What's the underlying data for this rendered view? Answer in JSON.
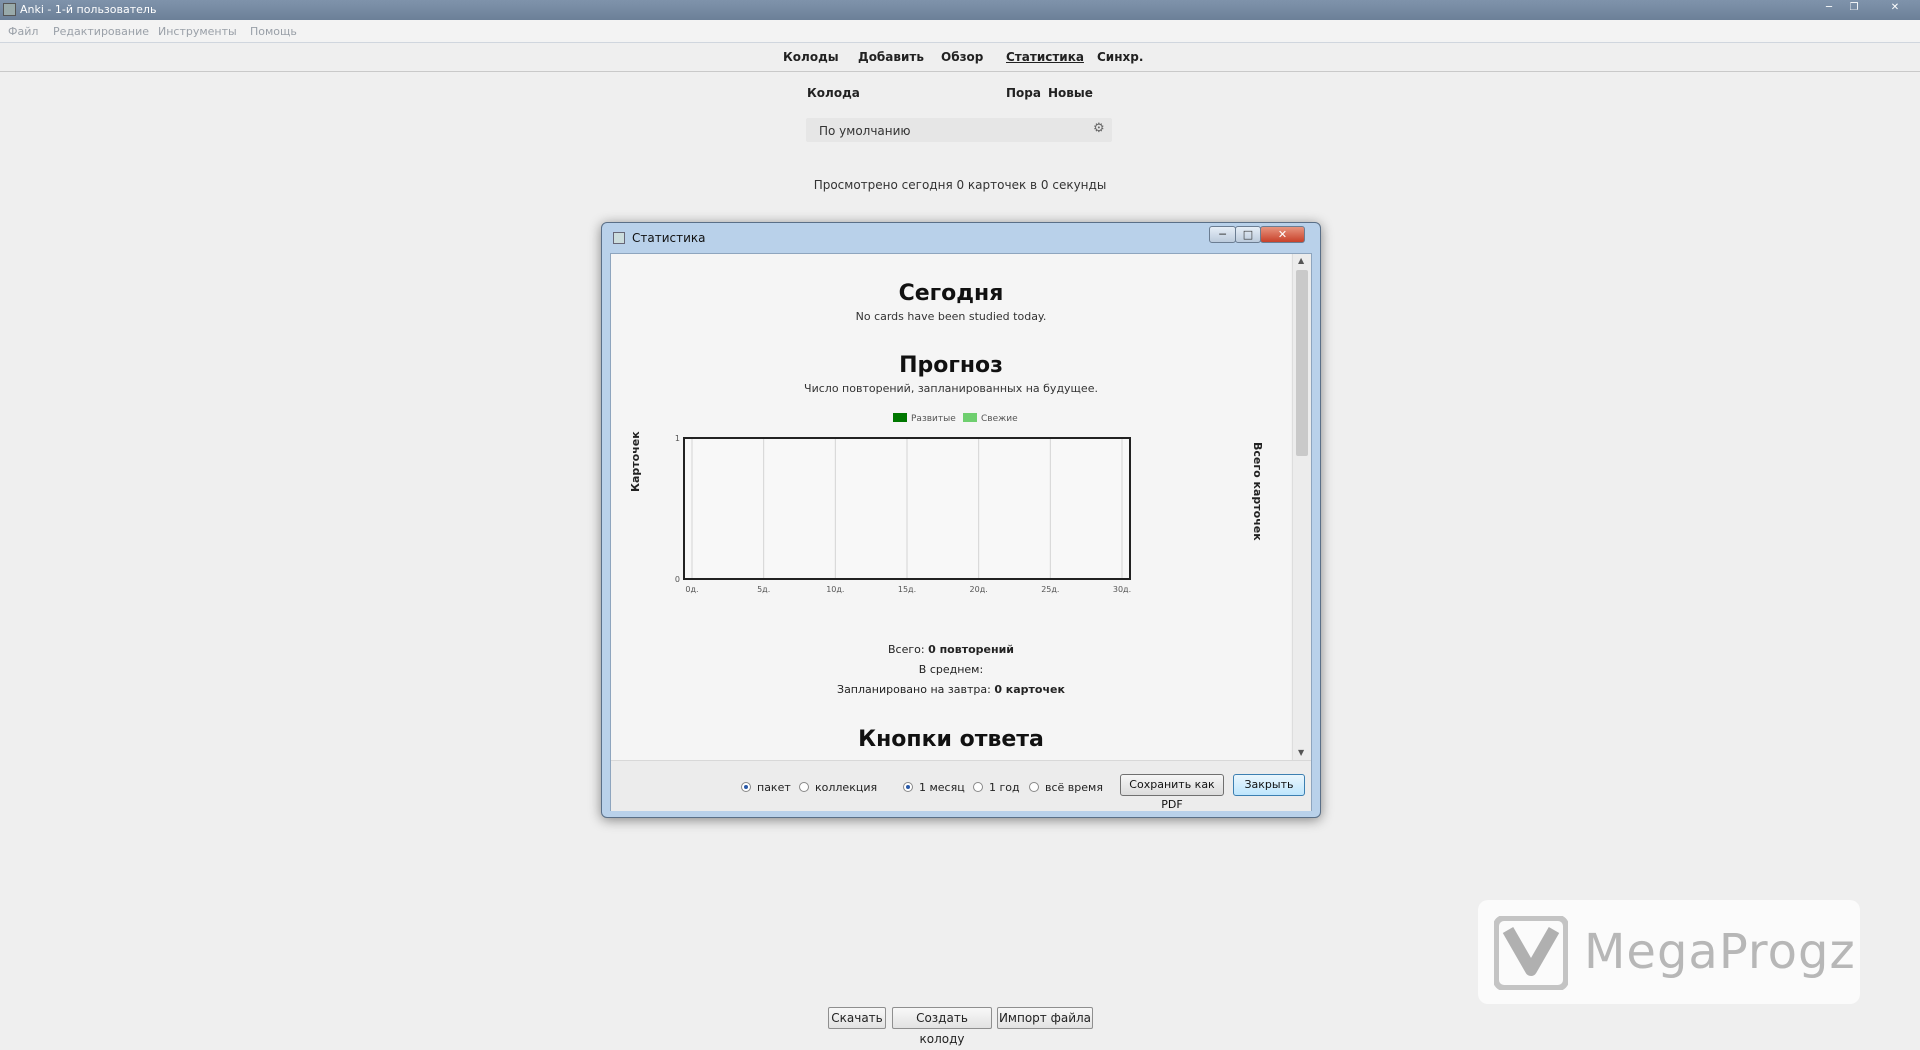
{
  "window": {
    "title": "Anki - 1-й пользователь"
  },
  "menu": [
    "Файл",
    "Редактирование",
    "Инструменты",
    "Помощь"
  ],
  "toolbar": {
    "items": [
      "Колоды",
      "Добавить",
      "Обзор",
      "Статистика",
      "Синхр."
    ],
    "active": "Статистика"
  },
  "decks": {
    "col_deck": "Колода",
    "col_due": "Пора",
    "col_new": "Новые",
    "rows": [
      {
        "name": "По умолчанию"
      }
    ],
    "studied_text": "Просмотрено сегодня 0 карточек в 0 секунды"
  },
  "bottom_buttons": [
    "Скачать",
    "Создать колоду",
    "Импорт файла"
  ],
  "watermark": "MegaProgz",
  "stats_dialog": {
    "title": "Статистика",
    "today_heading": "Сегодня",
    "today_text": "No cards have been studied today.",
    "forecast_heading": "Прогноз",
    "forecast_subtitle": "Число повторений, запланированных на будущее.",
    "legend": [
      {
        "name": "Развитые",
        "color": "#007700"
      },
      {
        "name": "Свежие",
        "color": "#6fcf6f"
      }
    ],
    "y_left_label": "Карточек",
    "y_right_label": "Всего карточек",
    "total_label": "Всего:",
    "total_value": "0 повторений",
    "avg_label": "В среднем:",
    "tomorrow_label": "Запланировано на завтра:",
    "tomorrow_value": "0 карточек",
    "answers_heading": "Кнопки ответа",
    "scope_options": [
      {
        "label": "пакет",
        "selected": true
      },
      {
        "label": "коллекция",
        "selected": false
      }
    ],
    "period_options": [
      {
        "label": "1 месяц",
        "selected": true
      },
      {
        "label": "1 год",
        "selected": false
      },
      {
        "label": "всё время",
        "selected": false
      }
    ],
    "save_pdf_label": "Сохранить как PDF",
    "close_label": "Закрыть"
  },
  "chart_data": {
    "type": "bar",
    "title": "",
    "x": [
      "0д.",
      "5д.",
      "10д.",
      "15д.",
      "20д.",
      "25д.",
      "30д."
    ],
    "xlim": [
      0,
      30
    ],
    "ylim": [
      0,
      1
    ],
    "y_ticks": [
      "0",
      "1"
    ],
    "ylabel": "Карточек",
    "ylabel_right": "Всего карточек",
    "series": [
      {
        "name": "Развитые",
        "values": []
      },
      {
        "name": "Свежие",
        "values": []
      }
    ],
    "grid": true,
    "legend_position": "top"
  }
}
